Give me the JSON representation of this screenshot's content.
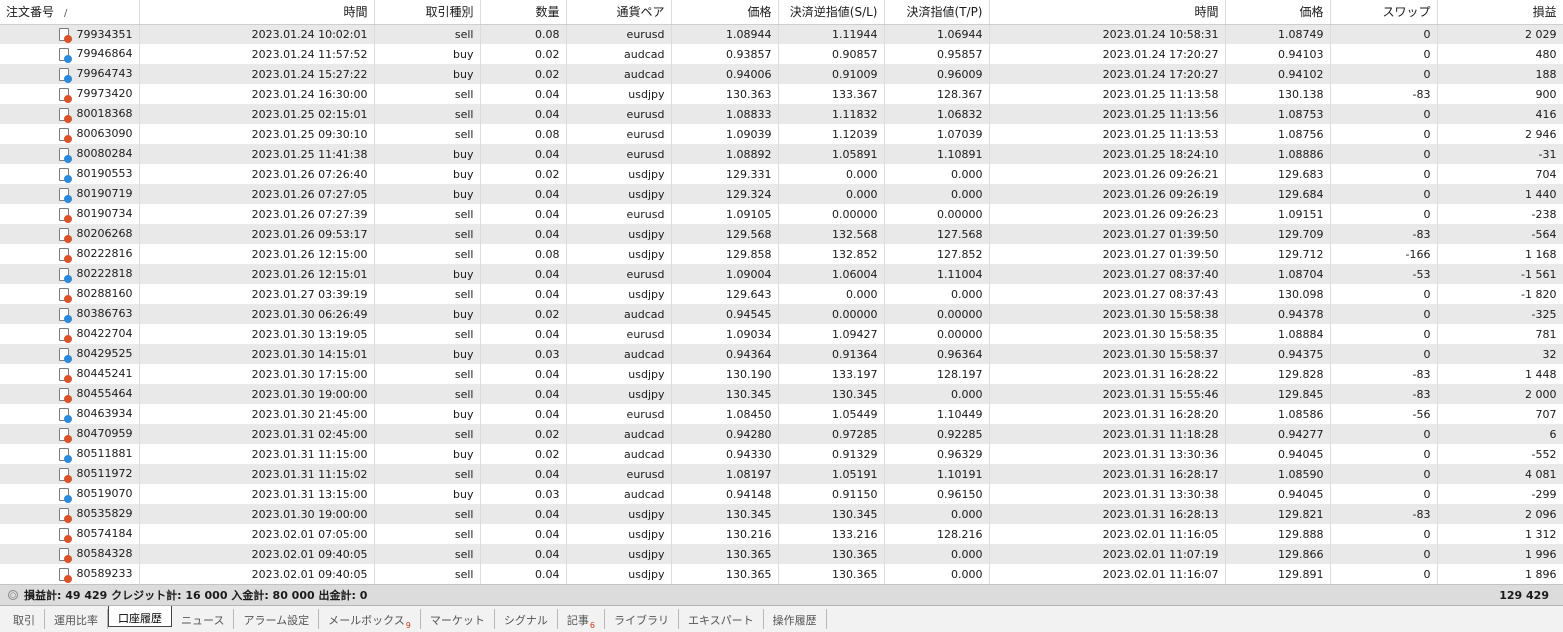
{
  "columns": [
    "注文番号",
    "時間",
    "取引種別",
    "数量",
    "通貨ペア",
    "価格",
    "決済逆指値(S/L)",
    "決済指値(T/P)",
    "時間",
    "価格",
    "スワップ",
    "損益"
  ],
  "sort_indicator": "/",
  "rows": [
    [
      "79934351",
      "2023.01.24 10:02:01",
      "sell",
      "0.08",
      "eurusd",
      "1.08944",
      "1.11944",
      "1.06944",
      "2023.01.24 10:58:31",
      "1.08749",
      "0",
      "2 029"
    ],
    [
      "79946864",
      "2023.01.24 11:57:52",
      "buy",
      "0.02",
      "audcad",
      "0.93857",
      "0.90857",
      "0.95857",
      "2023.01.24 17:20:27",
      "0.94103",
      "0",
      "480"
    ],
    [
      "79964743",
      "2023.01.24 15:27:22",
      "buy",
      "0.02",
      "audcad",
      "0.94006",
      "0.91009",
      "0.96009",
      "2023.01.24 17:20:27",
      "0.94102",
      "0",
      "188"
    ],
    [
      "79973420",
      "2023.01.24 16:30:00",
      "sell",
      "0.04",
      "usdjpy",
      "130.363",
      "133.367",
      "128.367",
      "2023.01.25 11:13:58",
      "130.138",
      "-83",
      "900"
    ],
    [
      "80018368",
      "2023.01.25 02:15:01",
      "sell",
      "0.04",
      "eurusd",
      "1.08833",
      "1.11832",
      "1.06832",
      "2023.01.25 11:13:56",
      "1.08753",
      "0",
      "416"
    ],
    [
      "80063090",
      "2023.01.25 09:30:10",
      "sell",
      "0.08",
      "eurusd",
      "1.09039",
      "1.12039",
      "1.07039",
      "2023.01.25 11:13:53",
      "1.08756",
      "0",
      "2 946"
    ],
    [
      "80080284",
      "2023.01.25 11:41:38",
      "buy",
      "0.04",
      "eurusd",
      "1.08892",
      "1.05891",
      "1.10891",
      "2023.01.25 18:24:10",
      "1.08886",
      "0",
      "-31"
    ],
    [
      "80190553",
      "2023.01.26 07:26:40",
      "buy",
      "0.02",
      "usdjpy",
      "129.331",
      "0.000",
      "0.000",
      "2023.01.26 09:26:21",
      "129.683",
      "0",
      "704"
    ],
    [
      "80190719",
      "2023.01.26 07:27:05",
      "buy",
      "0.04",
      "usdjpy",
      "129.324",
      "0.000",
      "0.000",
      "2023.01.26 09:26:19",
      "129.684",
      "0",
      "1 440"
    ],
    [
      "80190734",
      "2023.01.26 07:27:39",
      "sell",
      "0.04",
      "eurusd",
      "1.09105",
      "0.00000",
      "0.00000",
      "2023.01.26 09:26:23",
      "1.09151",
      "0",
      "-238"
    ],
    [
      "80206268",
      "2023.01.26 09:53:17",
      "sell",
      "0.04",
      "usdjpy",
      "129.568",
      "132.568",
      "127.568",
      "2023.01.27 01:39:50",
      "129.709",
      "-83",
      "-564"
    ],
    [
      "80222816",
      "2023.01.26 12:15:00",
      "sell",
      "0.08",
      "usdjpy",
      "129.858",
      "132.852",
      "127.852",
      "2023.01.27 01:39:50",
      "129.712",
      "-166",
      "1 168"
    ],
    [
      "80222818",
      "2023.01.26 12:15:01",
      "buy",
      "0.04",
      "eurusd",
      "1.09004",
      "1.06004",
      "1.11004",
      "2023.01.27 08:37:40",
      "1.08704",
      "-53",
      "-1 561"
    ],
    [
      "80288160",
      "2023.01.27 03:39:19",
      "sell",
      "0.04",
      "usdjpy",
      "129.643",
      "0.000",
      "0.000",
      "2023.01.27 08:37:43",
      "130.098",
      "0",
      "-1 820"
    ],
    [
      "80386763",
      "2023.01.30 06:26:49",
      "buy",
      "0.02",
      "audcad",
      "0.94545",
      "0.00000",
      "0.00000",
      "2023.01.30 15:58:38",
      "0.94378",
      "0",
      "-325"
    ],
    [
      "80422704",
      "2023.01.30 13:19:05",
      "sell",
      "0.04",
      "eurusd",
      "1.09034",
      "1.09427",
      "0.00000",
      "2023.01.30 15:58:35",
      "1.08884",
      "0",
      "781"
    ],
    [
      "80429525",
      "2023.01.30 14:15:01",
      "buy",
      "0.03",
      "audcad",
      "0.94364",
      "0.91364",
      "0.96364",
      "2023.01.30 15:58:37",
      "0.94375",
      "0",
      "32"
    ],
    [
      "80445241",
      "2023.01.30 17:15:00",
      "sell",
      "0.04",
      "usdjpy",
      "130.190",
      "133.197",
      "128.197",
      "2023.01.31 16:28:22",
      "129.828",
      "-83",
      "1 448"
    ],
    [
      "80455464",
      "2023.01.30 19:00:00",
      "sell",
      "0.04",
      "usdjpy",
      "130.345",
      "130.345",
      "0.000",
      "2023.01.31 15:55:46",
      "129.845",
      "-83",
      "2 000"
    ],
    [
      "80463934",
      "2023.01.30 21:45:00",
      "buy",
      "0.04",
      "eurusd",
      "1.08450",
      "1.05449",
      "1.10449",
      "2023.01.31 16:28:20",
      "1.08586",
      "-56",
      "707"
    ],
    [
      "80470959",
      "2023.01.31 02:45:00",
      "sell",
      "0.02",
      "audcad",
      "0.94280",
      "0.97285",
      "0.92285",
      "2023.01.31 11:18:28",
      "0.94277",
      "0",
      "6"
    ],
    [
      "80511881",
      "2023.01.31 11:15:00",
      "buy",
      "0.02",
      "audcad",
      "0.94330",
      "0.91329",
      "0.96329",
      "2023.01.31 13:30:36",
      "0.94045",
      "0",
      "-552"
    ],
    [
      "80511972",
      "2023.01.31 11:15:02",
      "sell",
      "0.04",
      "eurusd",
      "1.08197",
      "1.05191",
      "1.10191",
      "2023.01.31 16:28:17",
      "1.08590",
      "0",
      "4 081"
    ],
    [
      "80519070",
      "2023.01.31 13:15:00",
      "buy",
      "0.03",
      "audcad",
      "0.94148",
      "0.91150",
      "0.96150",
      "2023.01.31 13:30:38",
      "0.94045",
      "0",
      "-299"
    ],
    [
      "80535829",
      "2023.01.30 19:00:00",
      "sell",
      "0.04",
      "usdjpy",
      "130.345",
      "130.345",
      "0.000",
      "2023.01.31 16:28:13",
      "129.821",
      "-83",
      "2 096"
    ],
    [
      "80574184",
      "2023.02.01 07:05:00",
      "sell",
      "0.04",
      "usdjpy",
      "130.216",
      "133.216",
      "128.216",
      "2023.02.01 11:16:05",
      "129.888",
      "0",
      "1 312"
    ],
    [
      "80584328",
      "2023.02.01 09:40:05",
      "sell",
      "0.04",
      "usdjpy",
      "130.365",
      "130.365",
      "0.000",
      "2023.02.01 11:07:19",
      "129.866",
      "0",
      "1 996"
    ],
    [
      "80589233",
      "2023.02.01 09:40:05",
      "sell",
      "0.04",
      "usdjpy",
      "130.365",
      "130.365",
      "0.000",
      "2023.02.01 11:16:07",
      "129.891",
      "0",
      "1 896"
    ]
  ],
  "summary": {
    "text": "損益計: 49 429  クレジット計: 16 000  入金計: 80 000  出金計: 0",
    "total": "129 429"
  },
  "tabs": [
    {
      "label": "取引",
      "badge": "",
      "active": false
    },
    {
      "label": "運用比率",
      "badge": "",
      "active": false
    },
    {
      "label": "口座履歴",
      "badge": "",
      "active": true
    },
    {
      "label": "ニュース",
      "badge": "",
      "active": false
    },
    {
      "label": "アラーム設定",
      "badge": "",
      "active": false
    },
    {
      "label": "メールボックス",
      "badge": "9",
      "active": false
    },
    {
      "label": "マーケット",
      "badge": "",
      "active": false
    },
    {
      "label": "シグナル",
      "badge": "",
      "active": false
    },
    {
      "label": "記事",
      "badge": "6",
      "active": false
    },
    {
      "label": "ライブラリ",
      "badge": "",
      "active": false
    },
    {
      "label": "エキスパート",
      "badge": "",
      "active": false
    },
    {
      "label": "操作履歴",
      "badge": "",
      "active": false
    }
  ],
  "colors": {
    "sell_icon": "#d9532b",
    "buy_icon": "#2b8ad9",
    "row_alt": "#e9e9e9",
    "summary_bg": "#dcdcdc"
  }
}
